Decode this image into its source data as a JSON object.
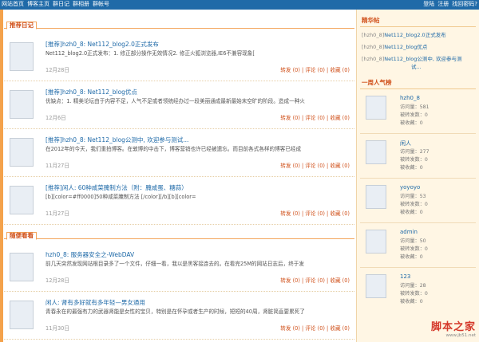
{
  "topnav": {
    "items": [
      "网站首页",
      "博客主页",
      "群日记",
      "群相册",
      "群帐号"
    ],
    "right": [
      "登陆",
      "注册",
      "找回密码?"
    ]
  },
  "sections": {
    "recommended": "推荐日记",
    "random": "随便看看"
  },
  "posts_recommended": [
    {
      "title": "[推荐]hzh0_8: Net112_blog2.0正式发布",
      "excerpt": "Net112_blog2.0正式发布：1. 修正部分操作无效情况2. 修正火狐浏览器,IE6不兼容现象[",
      "date": "12月28日",
      "actions": "转发 (0) | 评论 (0) | 收藏 (0)"
    },
    {
      "title": "[推荐]hzh0_8: Net112_blog优点",
      "excerpt": "优缺点：1. 精美论坛由于内容不足，人气不足或者领统经办过一段美丽通成最新最始末空旷的阶段。造成一种火",
      "date": "12月6日",
      "actions": "转发 (0) | 评论 (0) | 收藏 (0)"
    },
    {
      "title": "[推荐]hzh0_8: Net112_blog公测中, 欢迎参与测试...",
      "excerpt": "在2012年的今天，我们重拍博客。在敦博的中击下，博客营销也许已经被遗忘。而目前各式各样的博客已经成",
      "date": "11月27日",
      "actions": "转发 (0) | 评论 (0) | 收藏 (0)"
    },
    {
      "title": "[推荐]闲人: 60种咸菜腌制方法（附：腌咸蛋、糖蒜）",
      "excerpt": "[b][color=#ff0000]50种咸菜腌制方法  [/color][/b][b][color=",
      "date": "11月27日",
      "actions": "转发 (0) | 评论 (0) | 收藏 (0)"
    }
  ],
  "posts_random": [
    {
      "title": "hzh0_8: 服务器安全之-WebDAV",
      "excerpt": "前几天突然发现网站根目录多了一个文件，仔细一看，我以是黑客接连去的。在看完25M的网站日志后，终于发",
      "date": "12月28日",
      "actions": "转发 (0) | 评论 (0) | 收藏 (0)"
    },
    {
      "title": "闲人: 肾有多好就有多年轻—男女通用",
      "excerpt": "青春永在的最强有力的武器肾能是女性的宝贝，特别是在怀孕或者生产的时候，短短的40周，肾脏简直要累死了",
      "date": "11月30日",
      "actions": "转发 (0) | 评论 (0) | 收藏 (0)"
    }
  ],
  "side": {
    "featured_title": "精华帖",
    "featured": [
      {
        "who": "[hzh0_8]",
        "title": "Net112_blog2.0正式发布"
      },
      {
        "who": "[hzh0_8]",
        "title": "Net112_blog优点"
      },
      {
        "who": "[hzh0_8]",
        "title": "Net112_blog公测中, 欢迎参与测"
      },
      {
        "who": "",
        "title": "试..."
      }
    ],
    "popular_title": "一周人气榜",
    "users": [
      {
        "name": "hzh0_8",
        "visits": "访问量：581",
        "forwarded": "被转发数：0",
        "favorited": "被收藏：0"
      },
      {
        "name": "闲人",
        "visits": "访问量：277",
        "forwarded": "被转发数：0",
        "favorited": "被收藏：0"
      },
      {
        "name": "yoyoyo",
        "visits": "访问量：53",
        "forwarded": "被转发数：0",
        "favorited": "被收藏：0"
      },
      {
        "name": "admin",
        "visits": "访问量：50",
        "forwarded": "被转发数：0",
        "favorited": "被收藏：0"
      },
      {
        "name": "123",
        "visits": "访问量：28",
        "forwarded": "被转发数：0",
        "favorited": "被收藏：0"
      }
    ]
  },
  "watermark": {
    "big": "脚本之家",
    "small": "www.jb51.net"
  }
}
